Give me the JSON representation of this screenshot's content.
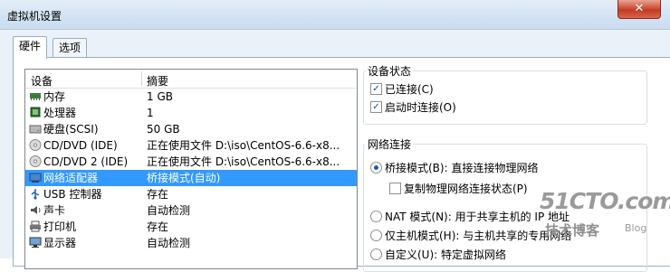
{
  "window": {
    "title": "虚拟机设置",
    "close_glyph": "✕"
  },
  "tabs": [
    {
      "label": "硬件",
      "active": true
    },
    {
      "label": "选项",
      "active": false
    }
  ],
  "device_list": {
    "headers": {
      "device": "设备",
      "summary": "摘要"
    },
    "rows": [
      {
        "icon": "memory-icon",
        "name": "内存",
        "summary": "1 GB",
        "selected": false
      },
      {
        "icon": "processor-icon",
        "name": "处理器",
        "summary": "1",
        "selected": false
      },
      {
        "icon": "hard-disk-icon",
        "name": "硬盘(SCSI)",
        "summary": "50 GB",
        "selected": false
      },
      {
        "icon": "cd-dvd-icon",
        "name": "CD/DVD (IDE)",
        "summary": "正在使用文件 D:\\iso\\CentOS-6.6-x8...",
        "selected": false
      },
      {
        "icon": "cd-dvd-icon",
        "name": "CD/DVD 2 (IDE)",
        "summary": "正在使用文件 D:\\iso\\CentOS-6.6-x8...",
        "selected": false
      },
      {
        "icon": "network-adapter-icon",
        "name": "网络适配器",
        "summary": "桥接模式(自动)",
        "selected": true
      },
      {
        "icon": "usb-icon",
        "name": "USB 控制器",
        "summary": "存在",
        "selected": false
      },
      {
        "icon": "sound-card-icon",
        "name": "声卡",
        "summary": "自动检测",
        "selected": false
      },
      {
        "icon": "printer-icon",
        "name": "打印机",
        "summary": "存在",
        "selected": false
      },
      {
        "icon": "display-icon",
        "name": "显示器",
        "summary": "自动检测",
        "selected": false
      }
    ]
  },
  "device_status": {
    "title": "设备状态",
    "connected": {
      "label": "已连接(C)",
      "checked": true
    },
    "connect_at_power_on": {
      "label": "启动时连接(O)",
      "checked": true
    }
  },
  "network_connection": {
    "title": "网络连接",
    "bridged": {
      "label": "桥接模式(B): 直接连接物理网络",
      "selected": true
    },
    "replicate": {
      "label": "复制物理网络连接状态(P)",
      "checked": false
    },
    "nat": {
      "label": "NAT 模式(N): 用于共享主机的 IP 地址",
      "selected": false
    },
    "host_only": {
      "label": "仅主机模式(H): 与主机共享的专用网络",
      "selected": false
    },
    "custom": {
      "label": "自定义(U): 特定虚拟网络",
      "selected": false
    }
  },
  "watermark": {
    "logo": "51CTO.com",
    "subtitle": "技术博客",
    "blog": "Blog"
  }
}
